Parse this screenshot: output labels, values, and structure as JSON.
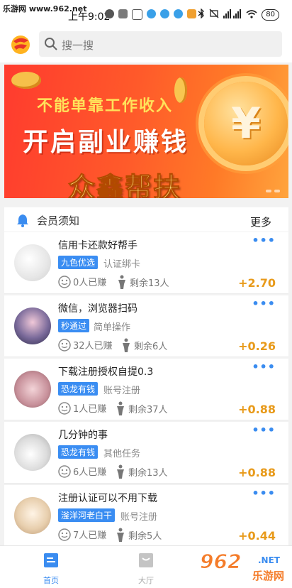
{
  "status_bar": {
    "watermark": "乐游网 www.962.net",
    "time": "上午9:02",
    "battery": "80"
  },
  "search": {
    "placeholder": "搜一搜"
  },
  "banner": {
    "line1": "不能单靠工作收入",
    "line2": "开启副业赚钱",
    "brand": "众鑫帮扶",
    "coin_symbol": "¥"
  },
  "notice": {
    "title": "会员须知",
    "more": "更多"
  },
  "tasks": [
    {
      "title": "信用卡还款好帮手",
      "tag": "九色优选",
      "category": "认证绑卡",
      "earned": "0人已赚",
      "remaining": "剩余13人",
      "reward": "+2.70",
      "more": "•••"
    },
    {
      "title": "微信，浏览器扫码",
      "tag": "秒通过",
      "category": "简单操作",
      "earned": "32人已赚",
      "remaining": "剩余6人",
      "reward": "+0.26",
      "more": "•••"
    },
    {
      "title": "下载注册授权自提0.3",
      "tag": "恐龙有钱",
      "category": "账号注册",
      "earned": "1人已赚",
      "remaining": "剩余37人",
      "reward": "+0.88",
      "more": "•••"
    },
    {
      "title": "几分钟的事",
      "tag": "恐龙有钱",
      "category": "其他任务",
      "earned": "6人已赚",
      "remaining": "剩余13人",
      "reward": "+0.88",
      "more": "•••"
    },
    {
      "title": "注册认证可以不用下载",
      "tag": "滏洋河老白干",
      "category": "账号注册",
      "earned": "7人已赚",
      "remaining": "剩余5人",
      "reward": "+0.44",
      "more": "•••"
    }
  ],
  "nav": {
    "home": "首页",
    "hall": "大厅"
  },
  "watermark_bottom": {
    "brand": "962",
    "net": ".NET",
    "cn": "乐游网"
  },
  "colors": {
    "accent": "#3a8cf0",
    "reward": "#e89a1a",
    "banner": "#ff4a2c"
  }
}
